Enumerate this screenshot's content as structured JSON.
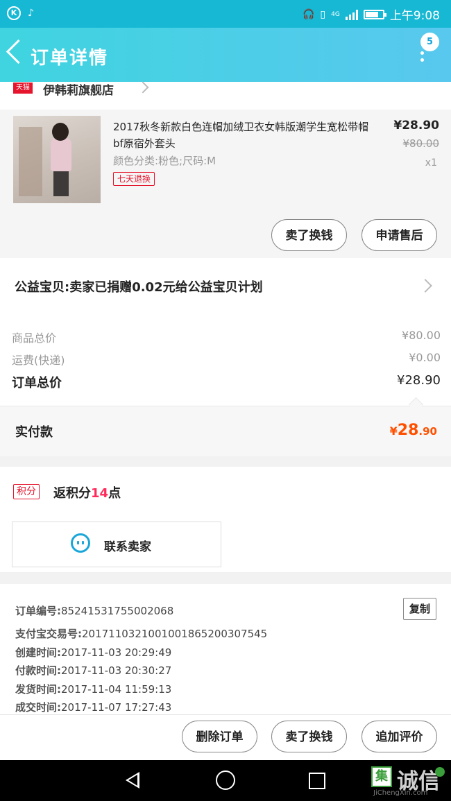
{
  "status_bar": {
    "time": "上午9:08",
    "network": "4G",
    "left_icon": "K"
  },
  "header": {
    "title": "订单详情",
    "badge": "5"
  },
  "shop": {
    "platform": "天猫",
    "name": "伊韩莉旗舰店"
  },
  "product": {
    "title": "2017秋冬新款白色连帽加绒卫衣女韩版潮学生宽松带帽bf原宿外套头",
    "sku": "颜色分类:粉色;尺码:M",
    "return_tag": "七天退换",
    "price": "¥28.90",
    "original_price": "¥80.00",
    "quantity": "x1",
    "btn_refund": "卖了换钱",
    "btn_aftersale": "申请售后"
  },
  "charity": {
    "text": "公益宝贝:卖家已捐赠0.02元给公益宝贝计划"
  },
  "totals": {
    "goods_label": "商品总价",
    "goods_value": "¥80.00",
    "shipping_label": "运费(快递)",
    "shipping_value": "¥0.00",
    "order_label": "订单总价",
    "order_value": "¥28.90",
    "paid_label": "实付款",
    "paid_currency": "¥",
    "paid_int": "28",
    "paid_dec": ".90"
  },
  "points": {
    "tag": "积分",
    "prefix": "返积分",
    "num": "14",
    "suffix": "点"
  },
  "contact": {
    "label": "联系卖家"
  },
  "order_info": {
    "copy": "复制",
    "order_no_label": "订单编号:",
    "order_no": "85241531755002068",
    "alipay_label": "支付宝交易号:",
    "alipay_no": "2017110321001001865200307545",
    "created_label": "创建时间:",
    "created": "2017-11-03 20:29:49",
    "paid_label": "付款时间:",
    "paid": "2017-11-03 20:30:27",
    "shipped_label": "发货时间:",
    "shipped": "2017-11-04 11:59:13",
    "done_label": "成交时间:",
    "done": "2017-11-07 17:27:43"
  },
  "actions": {
    "delete": "删除订单",
    "sell": "卖了换钱",
    "review": "追加评价"
  },
  "watermark": {
    "box": "集",
    "text": "诚信",
    "url": "JiChengXin.com"
  }
}
